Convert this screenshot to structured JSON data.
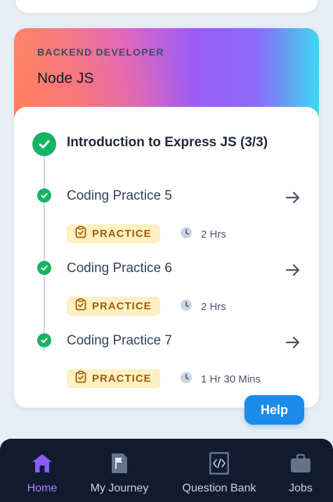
{
  "course": {
    "category": "BACKEND DEVELOPER",
    "title": "Node JS",
    "module_title": "Introduction to Express JS (3/3)",
    "items": [
      {
        "title": "Coding Practice 5",
        "badge": "PRACTICE",
        "duration": "2 Hrs"
      },
      {
        "title": "Coding Practice 6",
        "badge": "PRACTICE",
        "duration": "2 Hrs"
      },
      {
        "title": "Coding Practice 7",
        "badge": "PRACTICE",
        "duration": "1 Hr 30 Mins"
      }
    ]
  },
  "help": {
    "label": "Help"
  },
  "nav": {
    "items": [
      {
        "label": "Home",
        "icon": "home-icon",
        "active": true
      },
      {
        "label": "My Journey",
        "icon": "flag-icon",
        "active": false
      },
      {
        "label": "Question Bank",
        "icon": "code-book-icon",
        "active": false
      },
      {
        "label": "Jobs",
        "icon": "briefcase-icon",
        "active": false
      }
    ]
  },
  "colors": {
    "success": "#16b364",
    "accent": "#a78bfa",
    "help": "#1a8be8",
    "badge_bg": "#fdf0c2",
    "badge_text": "#a15c07",
    "nav_bg": "#111a2e"
  }
}
